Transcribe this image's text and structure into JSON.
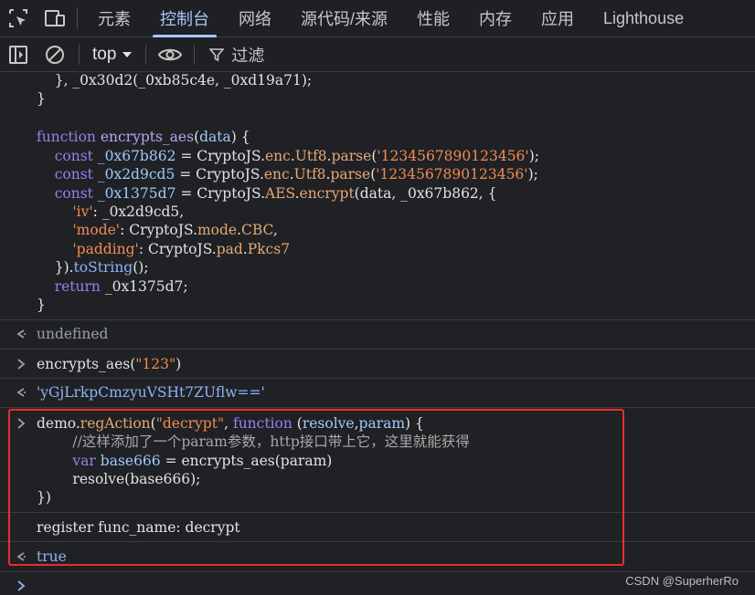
{
  "tabs": [
    "元素",
    "控制台",
    "网络",
    "源代码/来源",
    "性能",
    "内存",
    "应用",
    "Lighthouse"
  ],
  "toolbar": {
    "context": "top",
    "filter_label": "过滤"
  },
  "code_top": [
    "    }, _0x30d2(_0xb85c4e, _0xd19a71);",
    "}",
    "",
    "function encrypts_aes(data) {",
    "    const _0x67b862 = CryptoJS.enc.Utf8.parse('1234567890123456');",
    "    const _0x2d9cd5 = CryptoJS.enc.Utf8.parse('1234567890123456');",
    "    const _0x1375d7 = CryptoJS.AES.encrypt(data, _0x67b862, {",
    "        'iv': _0x2d9cd5,",
    "        'mode': CryptoJS.mode.CBC,",
    "        'padding': CryptoJS.pad.Pkcs7",
    "    }).toString();",
    "    return _0x1375d7;",
    "}"
  ],
  "entries": {
    "undefined": "undefined",
    "call": "encrypts_aes(\"123\")",
    "result": "'yGjLrkpCmzyuVSHt7ZUflw=='",
    "demo_lines": [
      "demo.regAction(\"decrypt\", function (resolve,param) {",
      "        //这样添加了一个param参数，http接口带上它，这里就能获得",
      "        var base666 = encrypts_aes(param)",
      "        resolve(base666);",
      "})"
    ],
    "register_log": "register func_name: decrypt",
    "true_value": "true"
  },
  "watermark": "CSDN @SuperherRo"
}
